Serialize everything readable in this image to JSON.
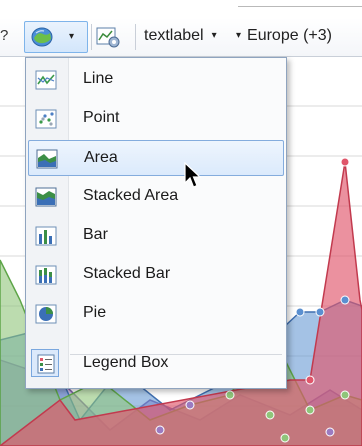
{
  "toolbar": {
    "partial_glyph": "?",
    "label_select": "textlabel",
    "region_select": "Europe (+3)",
    "caret": "▾"
  },
  "chart_type_button": {
    "icon": "chart-globe-icon",
    "caret": "▾"
  },
  "chart_settings_button": {
    "icon": "chart-settings-icon"
  },
  "menu": {
    "items": [
      {
        "label": "Line",
        "icon": "line-chart-icon"
      },
      {
        "label": "Point",
        "icon": "point-chart-icon"
      },
      {
        "label": "Area",
        "icon": "area-chart-icon"
      },
      {
        "label": "Stacked Area",
        "icon": "stacked-area-chart-icon"
      },
      {
        "label": "Bar",
        "icon": "bar-chart-icon"
      },
      {
        "label": "Stacked Bar",
        "icon": "stacked-bar-chart-icon"
      },
      {
        "label": "Pie",
        "icon": "pie-chart-icon"
      },
      {
        "label": "Legend Box",
        "icon": "legend-box-icon"
      }
    ],
    "hovered_item": "Area",
    "checked_item": "Legend Box"
  },
  "colors": {
    "series_red": "#e0566b",
    "series_green": "#8fc57a",
    "series_blue": "#5a8fd0",
    "series_purple": "#9b7bc1",
    "highlight_border": "#84acdd"
  }
}
